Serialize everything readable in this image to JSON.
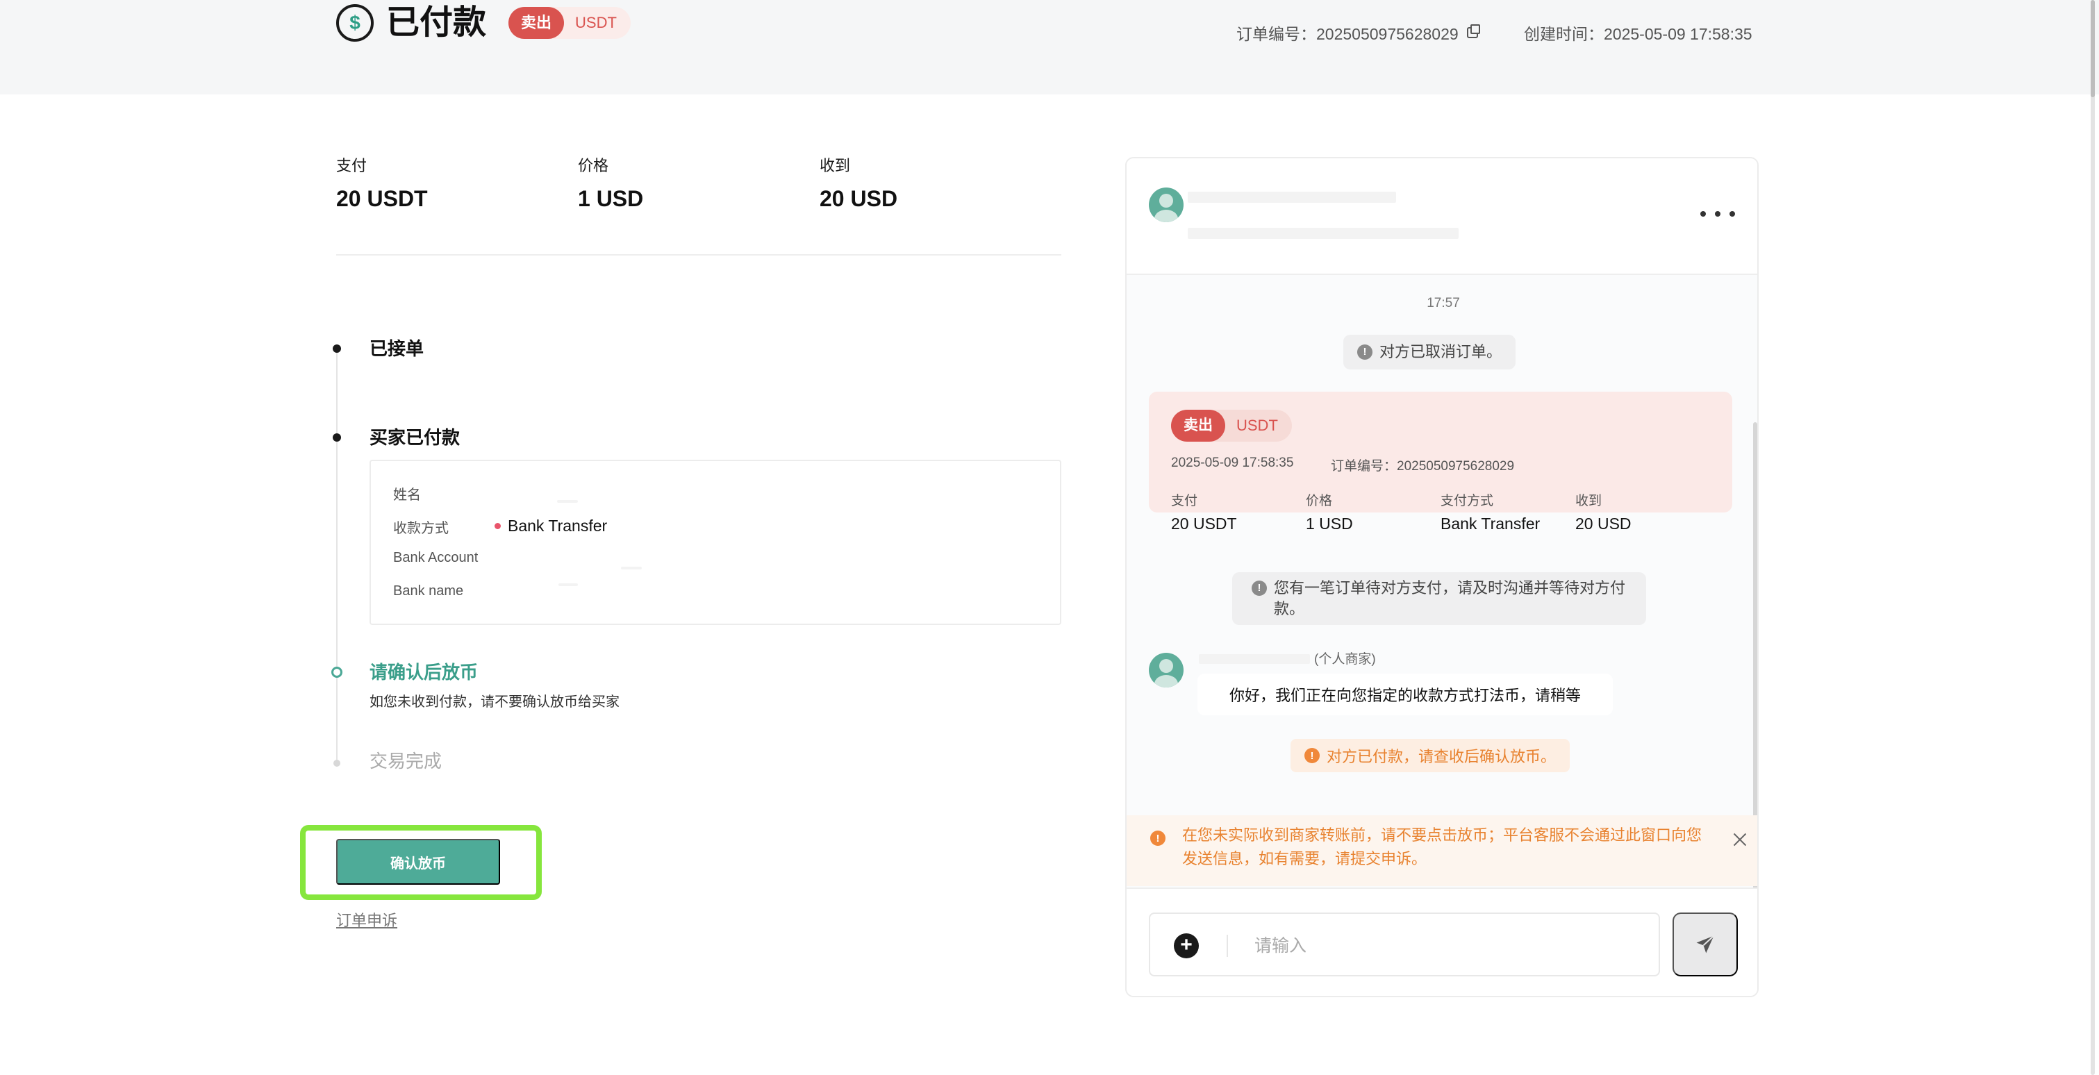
{
  "header": {
    "status_title": "已付款",
    "tag_sell": "卖出",
    "tag_coin": "USDT",
    "order_no": "订单编号：2025050975628029",
    "created_time": "创建时间：2025-05-09 17:58:35"
  },
  "summary": {
    "items": [
      {
        "label": "支付",
        "value": "20 USDT"
      },
      {
        "label": "价格",
        "value": "1 USD"
      },
      {
        "label": "收到",
        "value": "20 USD"
      }
    ]
  },
  "timeline": {
    "step1": "已接单",
    "step2": "买家已付款",
    "step3": "请确认后放币",
    "step3_sub": "如您未收到付款，请不要确认放币给买家",
    "step4": "交易完成"
  },
  "payment": {
    "name_label": "姓名",
    "method_label": "收款方式",
    "method_value": "Bank Transfer",
    "account_label": "Bank Account",
    "bank_name_label": "Bank name"
  },
  "actions": {
    "confirm_label": "确认放币",
    "appeal_label": "订单申诉"
  },
  "chat": {
    "time_stamp": "17:57",
    "cancelled_notice": "对方已取消订单。",
    "order_card": {
      "tag_sell": "卖出",
      "tag_coin": "USDT",
      "date": "2025-05-09 17:58:35",
      "order_no": "订单编号：2025050975628029",
      "cols": [
        {
          "label": "支付",
          "value": "20 USDT"
        },
        {
          "label": "价格",
          "value": "1 USD"
        },
        {
          "label": "支付方式",
          "value": "Bank Transfer"
        },
        {
          "label": "收到",
          "value": "20 USD"
        }
      ]
    },
    "pending_notice": "您有一笔订单待对方支付，请及时沟通并等待对方付款。",
    "merchant_tag": "(个人商家)",
    "message": "你好，我们正在向您指定的收款方式打法币，请稍等",
    "paid_notice": "对方已付款，请查收后确认放币。",
    "warning": "在您未实际收到商家转账前，请不要点击放币；平台客服不会通过此窗口向您发送信息，如有需要，请提交申诉。",
    "input_placeholder": "请输入"
  },
  "colors": {
    "accent": "#4eab98",
    "sell": "#d9534f",
    "warning": "#e8822f",
    "highlight": "#86e63d"
  }
}
